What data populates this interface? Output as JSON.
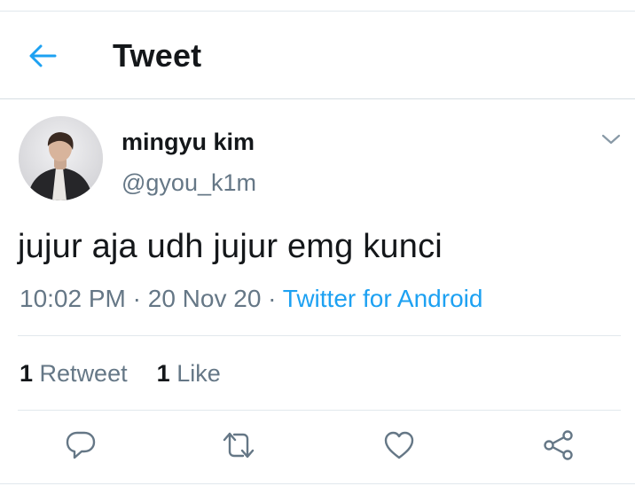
{
  "header": {
    "title": "Tweet",
    "back_icon": "arrow-left-icon",
    "accent_color": "#1da1f2"
  },
  "tweet": {
    "author": {
      "display_name": "mingyu kim",
      "handle": "@gyou_k1m",
      "avatar": "profile-photo"
    },
    "text": "jujur aja udh jujur emg kunci",
    "time": "10:02 PM",
    "separator": " · ",
    "date": "20 Nov 20",
    "source": "Twitter for Android",
    "stats": {
      "retweets_count": "1",
      "retweets_label": "Retweet",
      "likes_count": "1",
      "likes_label": "Like"
    },
    "actions": {
      "reply_icon": "reply-icon",
      "retweet_icon": "retweet-icon",
      "like_icon": "heart-icon",
      "share_icon": "share-icon"
    },
    "menu_icon": "chevron-down-icon"
  },
  "colors": {
    "text_primary": "#14171a",
    "text_secondary": "#657786",
    "link": "#1da1f2",
    "divider": "#e1e8ed"
  }
}
